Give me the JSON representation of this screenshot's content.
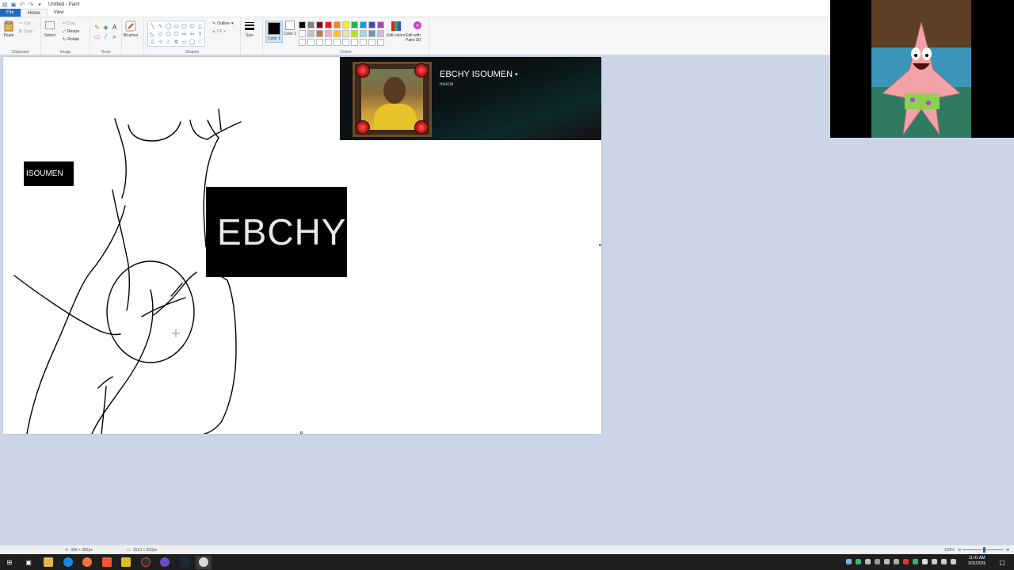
{
  "window": {
    "title": "Untitled - Paint"
  },
  "tabs": [
    {
      "label": "File"
    },
    {
      "label": "Home"
    },
    {
      "label": "View"
    }
  ],
  "ribbon": {
    "clipboard": {
      "label": "Clipboard",
      "paste": "Paste",
      "cut": "Cut",
      "copy": "Copy"
    },
    "image": {
      "label": "Image",
      "select": "Select",
      "crop": "Crop",
      "resize": "Resize",
      "rotate": "Rotate"
    },
    "tools": {
      "label": "Tools"
    },
    "brushes": {
      "label": "Brushes"
    },
    "shapes": {
      "label": "Shapes",
      "outline": "Outline",
      "fill": "Fill"
    },
    "size": {
      "label": "Size"
    },
    "colors": {
      "label": "Colors",
      "color1": "Color 1",
      "color2": "Color 2",
      "edit_colors": "Edit colors",
      "edit_paint3d": "Edit with Paint 3D",
      "color1_value": "#000000",
      "color2_value": "#ffffff",
      "palette": [
        "#000000",
        "#7f7f7f",
        "#880015",
        "#ed1c24",
        "#ff7f27",
        "#fff200",
        "#22b14c",
        "#00a2e8",
        "#3f48cc",
        "#a349a4",
        "#ffffff",
        "#c3c3c3",
        "#b97a57",
        "#ffaec9",
        "#ffc90e",
        "#efe4b0",
        "#b5e61d",
        "#99d9ea",
        "#7092be",
        "#c8bfe7",
        "#ffffff",
        "#ffffff",
        "#ffffff",
        "#ffffff",
        "#ffffff",
        "#ffffff",
        "#ffffff",
        "#ffffff",
        "#ffffff",
        "#ffffff"
      ]
    }
  },
  "canvas": {
    "small_label": "ISOUMEN",
    "big_label": "EBCHY I"
  },
  "profile": {
    "name": "EBCHY ISOUMEN",
    "subtitle": "HAKIM"
  },
  "status": {
    "cursor": "396 × 382px",
    "canvas_size": "1513 × 953px",
    "zoom": "100%"
  },
  "taskbar": {
    "time": "11:41 AM",
    "date": "3/31/2026"
  }
}
